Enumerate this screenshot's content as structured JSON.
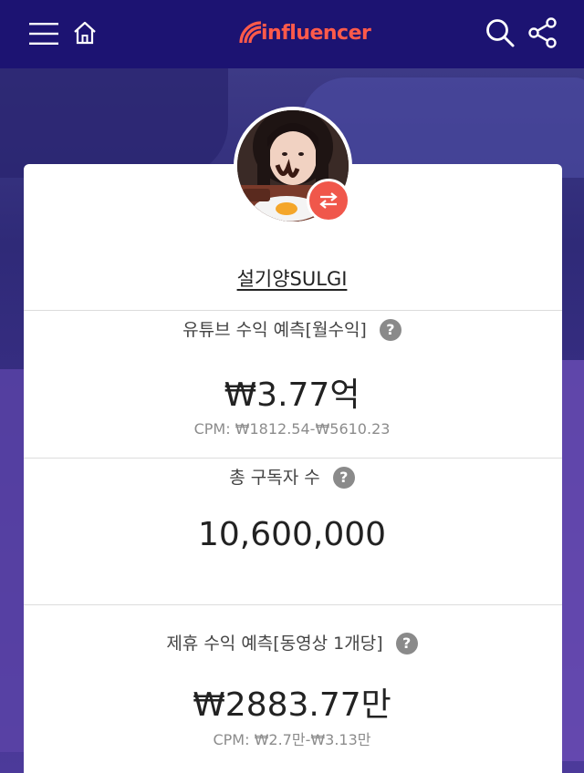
{
  "header": {
    "logo_text": "influencer",
    "brand_color": "#ff5a4a",
    "icons": [
      "menu-icon",
      "home-icon",
      "search-icon",
      "share-icon"
    ]
  },
  "profile": {
    "name": "설기양SULGI",
    "swap_icon": "swap-arrows-icon"
  },
  "sections": [
    {
      "label": "유튜브 수익 예측[월수익]",
      "value": "₩3.77억",
      "sub": "CPM: ₩1812.54-₩5610.23"
    },
    {
      "label": "총 구독자 수",
      "value": "10,600,000"
    },
    {
      "label": "제휴 수익 예측[동영상 1개당]",
      "value": "₩2883.77만",
      "sub": "CPM: ₩2.7만-₩3.13만"
    }
  ],
  "help_glyph": "?"
}
